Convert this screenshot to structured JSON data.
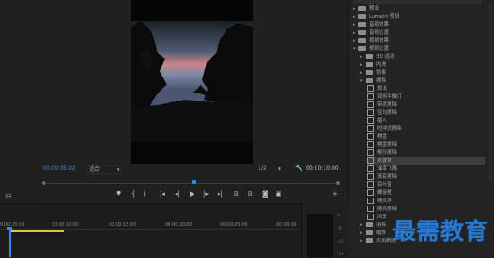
{
  "program_monitor": {
    "current_timecode": "00:00:05:02",
    "fit_label": "适合",
    "resolution_label": "1/2",
    "duration_timecode": "00:00:10:00"
  },
  "effects_panel": {
    "search_placeholder": "",
    "items": [
      {
        "label": "预设",
        "type": "folder"
      },
      {
        "label": "Lumetri 预设",
        "type": "folder"
      },
      {
        "label": "音频效果",
        "type": "folder"
      },
      {
        "label": "音频过渡",
        "type": "folder"
      },
      {
        "label": "视频效果",
        "type": "folder"
      },
      {
        "label": "视频过渡",
        "type": "folder",
        "expanded": true
      },
      {
        "label": "3D 运动",
        "type": "folder",
        "indent": 1
      },
      {
        "label": "内滑",
        "type": "folder",
        "indent": 1
      },
      {
        "label": "划像",
        "type": "folder",
        "indent": 1
      },
      {
        "label": "擦除",
        "type": "folder",
        "indent": 1,
        "expanded": true
      },
      {
        "label": "划出",
        "type": "effect",
        "indent": 2
      },
      {
        "label": "双侧平推门",
        "type": "effect",
        "indent": 2
      },
      {
        "label": "带状擦除",
        "type": "effect",
        "indent": 2
      },
      {
        "label": "径向擦除",
        "type": "effect",
        "indent": 2
      },
      {
        "label": "插入",
        "type": "effect",
        "indent": 2
      },
      {
        "label": "时钟式擦除",
        "type": "effect",
        "indent": 2
      },
      {
        "label": "棋盘",
        "type": "effect",
        "indent": 2
      },
      {
        "label": "棋盘擦除",
        "type": "effect",
        "indent": 2
      },
      {
        "label": "楔形擦除",
        "type": "effect",
        "indent": 2
      },
      {
        "label": "水波块",
        "type": "effect",
        "indent": 2,
        "selected": true
      },
      {
        "label": "油漆飞溅",
        "type": "effect",
        "indent": 2
      },
      {
        "label": "渐变擦除",
        "type": "effect",
        "indent": 2
      },
      {
        "label": "百叶窗",
        "type": "effect",
        "indent": 2
      },
      {
        "label": "螺旋框",
        "type": "effect",
        "indent": 2
      },
      {
        "label": "随机块",
        "type": "effect",
        "indent": 2
      },
      {
        "label": "随机擦除",
        "type": "effect",
        "indent": 2
      },
      {
        "label": "风车",
        "type": "effect",
        "indent": 2
      },
      {
        "label": "溶解",
        "type": "folder",
        "indent": 1
      },
      {
        "label": "缩放",
        "type": "folder",
        "indent": 1
      },
      {
        "label": "页面剥落",
        "type": "folder",
        "indent": 1
      }
    ]
  },
  "timeline": {
    "ruler_labels": [
      "0:00:05:00",
      "00:00:10:00",
      "00:00:15:00",
      "00:00:20:00",
      "00:00:25:00",
      "00:00:30"
    ]
  },
  "audio_meter": {
    "labels": [
      "0",
      "-6",
      "-12",
      "-18"
    ]
  },
  "watermark": {
    "text": "最需教育"
  }
}
